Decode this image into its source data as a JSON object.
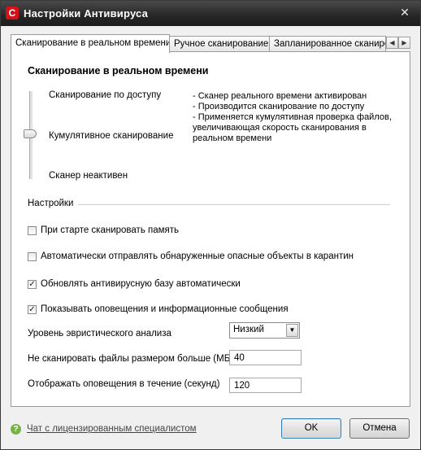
{
  "window": {
    "title": "Настройки Антивируса",
    "app_icon": "C"
  },
  "tabs": [
    {
      "label": "Сканирование в реальном времени",
      "active": true
    },
    {
      "label": "Ручное сканирование",
      "active": false
    },
    {
      "label": "Запланированное сканирование",
      "active": false
    }
  ],
  "realtime": {
    "section_title": "Сканирование в реальном времени",
    "levels": [
      "Сканирование по доступу",
      "Кумулятивное сканирование",
      "Сканер неактивен"
    ],
    "selected_level": "Кумулятивное сканирование",
    "description": [
      "- Сканер реального времени активирован",
      "- Производится сканирование по доступу",
      "- Применяется кумулятивная проверка файлов, увеличивающая скорость сканирования в реальном времени"
    ]
  },
  "settings": {
    "group_label": "Настройки",
    "checkboxes": [
      {
        "label": "При старте сканировать память",
        "checked": false
      },
      {
        "label": "Автоматически отправлять обнаруженные опасные объекты в карантин",
        "checked": false
      },
      {
        "label": "Обновлять антивирусную базу автоматически",
        "checked": true
      },
      {
        "label": "Показывать оповещения и информационные сообщения",
        "checked": true
      }
    ],
    "heuristic_label": "Уровень эвристического анализа",
    "heuristic_value": "Низкий",
    "max_size_label": "Не сканировать файлы размером больше (МБ)",
    "max_size_value": "40",
    "notify_label": "Отображать оповещения в течение (секунд)",
    "notify_value": "120"
  },
  "footer": {
    "help_link": "Чат с лицензированным специалистом",
    "ok_label": "OK",
    "cancel_label": "Отмена"
  }
}
